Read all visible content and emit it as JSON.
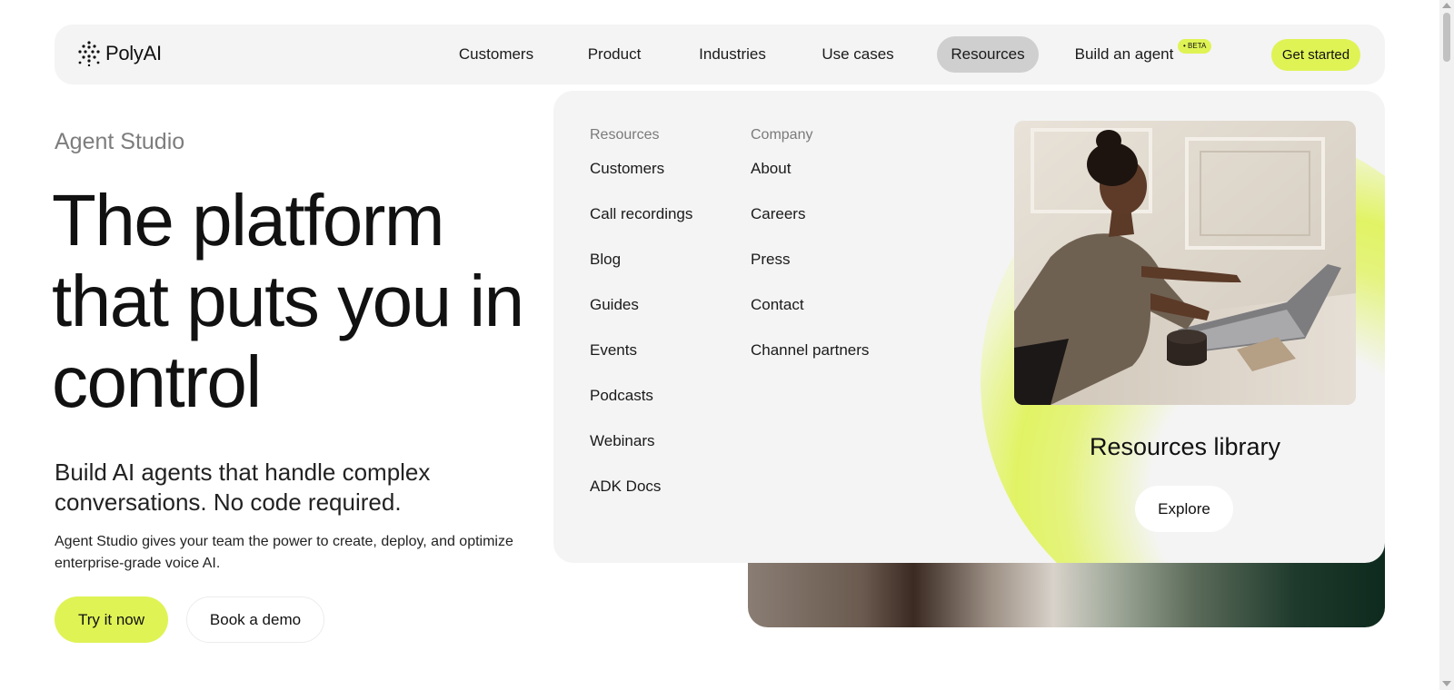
{
  "brand": {
    "name": "PolyAI",
    "accent_color": "#dff355"
  },
  "nav": {
    "links": [
      {
        "label": "Customers"
      },
      {
        "label": "Product"
      },
      {
        "label": "Industries"
      },
      {
        "label": "Use cases"
      },
      {
        "label": "Resources",
        "active": true
      },
      {
        "label": "Build an agent"
      }
    ],
    "beta_badge": "• BETA",
    "cta": "Get started"
  },
  "hero": {
    "eyebrow": "Agent Studio",
    "headline": "The platform that puts you in control",
    "subhead": "Build AI agents that handle complex conversations. No code required.",
    "body": "Agent Studio gives your team the power to create, deploy, and optimize enterprise-grade voice AI.",
    "primary_button": "Try it now",
    "secondary_button": "Book a demo"
  },
  "dropdown": {
    "resources": {
      "heading": "Resources",
      "items": [
        "Customers",
        "Call recordings",
        "Blog",
        "Guides",
        "Events",
        "Podcasts",
        "Webinars",
        "ADK Docs"
      ]
    },
    "company": {
      "heading": "Company",
      "items": [
        "About",
        "Careers",
        "Press",
        "Contact",
        "Channel partners"
      ]
    },
    "promo": {
      "title": "Resources library",
      "button": "Explore"
    }
  }
}
